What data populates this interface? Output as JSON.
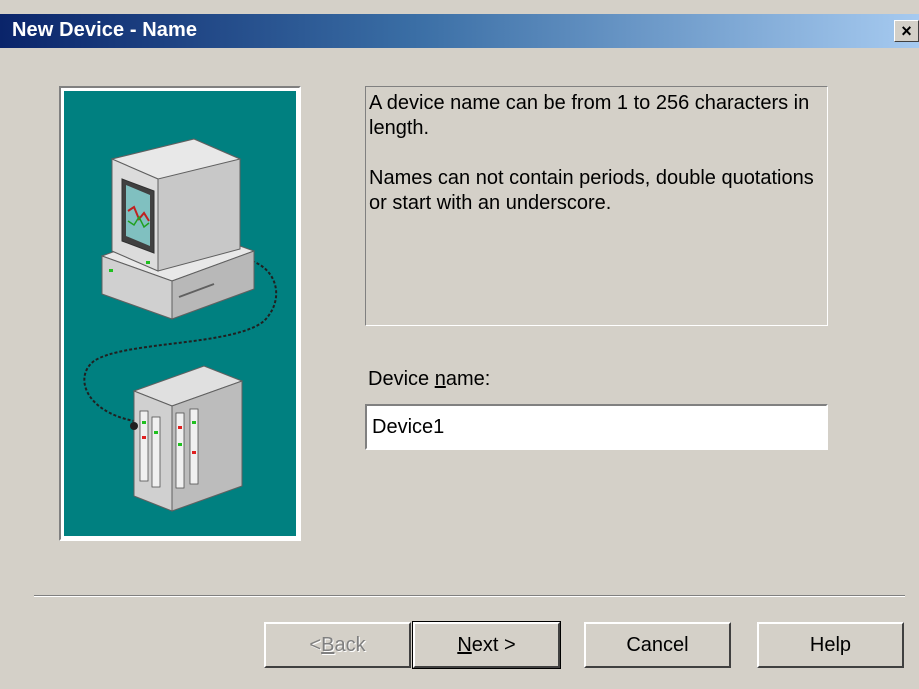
{
  "window": {
    "title": "New Device - Name",
    "close_glyph": "✕"
  },
  "info": {
    "paragraph1": "A device name can be from 1 to 256 characters in length.",
    "paragraph2": "Names can not contain periods, double quotations or start with an underscore."
  },
  "field": {
    "label_prefix": "Device ",
    "label_mnemonic": "n",
    "label_suffix": "ame:",
    "value": "Device1"
  },
  "buttons": {
    "back": {
      "prefix": "< ",
      "mnemonic": "B",
      "suffix": "ack",
      "enabled": false
    },
    "next": {
      "prefix": "",
      "mnemonic": "N",
      "suffix": "ext >",
      "enabled": true
    },
    "cancel": "Cancel",
    "help": "Help"
  },
  "illustration": {
    "icons": [
      "computer-monitor-icon",
      "network-cable-icon",
      "device-rack-icon"
    ],
    "background_color": "#008080"
  },
  "colors": {
    "dialog_bg": "#d4d0c8",
    "title_gradient_start": "#0a246a",
    "title_gradient_end": "#a6caf0"
  }
}
